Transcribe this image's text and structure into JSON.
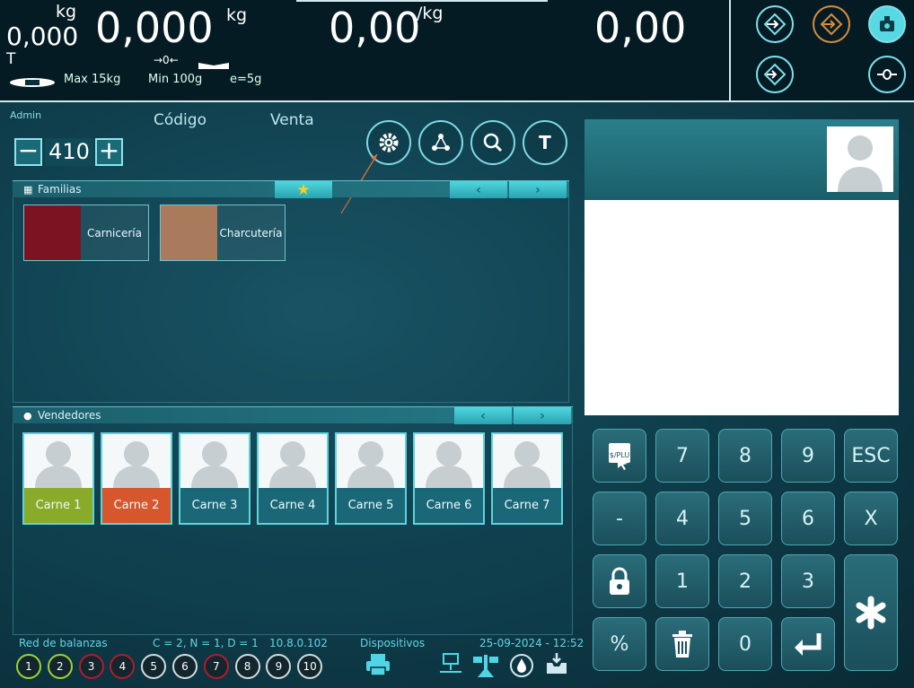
{
  "display": {
    "tare_unit": "kg",
    "tare_value": "0,000",
    "tare_label": "T",
    "weight_value": "0,000",
    "weight_unit": "kg",
    "price_value": "0,00",
    "price_unit": "/kg",
    "total_value": "0,00",
    "max": "Max 15kg",
    "min": "Min 100g",
    "e": "e=5g",
    "zero_symbol": "→0←"
  },
  "top_icons": [
    {
      "name": "arrow-target-icon"
    },
    {
      "name": "arrow-target-orange-icon"
    },
    {
      "name": "scale-icon"
    },
    {
      "name": "ft-target-icon"
    },
    {
      "name": "zero-icon"
    }
  ],
  "header": {
    "user": "Admin",
    "code_label": "Código",
    "sale_label": "Venta",
    "code_value": "410",
    "minus": "−",
    "plus": "+"
  },
  "toolbar": [
    {
      "name": "settings-icon"
    },
    {
      "name": "network-icon"
    },
    {
      "name": "search-icon"
    },
    {
      "name": "tare-icon",
      "text": "T"
    }
  ],
  "families": {
    "title": "Familias",
    "items": [
      {
        "name": "Carnicería",
        "color": "#7b1323"
      },
      {
        "name": "Charcutería",
        "color": "#a97a5c"
      }
    ]
  },
  "sellers": {
    "title": "Vendedores",
    "items": [
      {
        "name": "Carne 1",
        "color": "#8aab2a"
      },
      {
        "name": "Carne 2",
        "color": "#d6562d"
      },
      {
        "name": "Carne 3",
        "color": "#1a6877"
      },
      {
        "name": "Carne 4",
        "color": "#1a6877"
      },
      {
        "name": "Carne 5",
        "color": "#1a6877"
      },
      {
        "name": "Carne 6",
        "color": "#1a6877"
      },
      {
        "name": "Carne 7",
        "color": "#1a6877"
      }
    ]
  },
  "keypad": {
    "keys": [
      "7",
      "8",
      "9",
      "ESC",
      "-",
      "4",
      "5",
      "6",
      "X",
      "1",
      "2",
      "3",
      "%",
      "0"
    ],
    "plu": "$/PLU"
  },
  "status": {
    "network_label": "Red de balanzas",
    "cnd": "C = 2, N = 1, D = 1",
    "ip": "10.8.0.102",
    "devices": "Dispositivos",
    "datetime": "25-09-2024 - 12:52",
    "scales": [
      "1",
      "2",
      "3",
      "4",
      "5",
      "6",
      "7",
      "8",
      "9",
      "10"
    ]
  }
}
